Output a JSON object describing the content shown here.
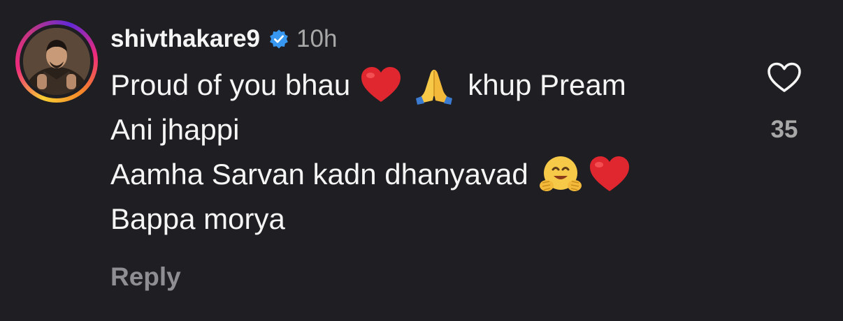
{
  "comment": {
    "username": "shivthakare9",
    "time": "10h",
    "lines": [
      {
        "before": "Proud of you bhau",
        "after": "khup Pream"
      },
      {
        "text": "Ani jhappi"
      },
      {
        "before": "Aamha Sarvan kadn dhanyavad"
      },
      {
        "text": "Bappa morya"
      }
    ],
    "reply_label": "Reply",
    "like_count": "35"
  },
  "icons": {
    "verified": "verified-badge-icon",
    "like": "heart-outline-icon",
    "emoji_heart": "red-heart-emoji",
    "emoji_pray": "folded-hands-emoji",
    "emoji_hug": "hugging-face-emoji"
  },
  "colors": {
    "background": "#1f1f23",
    "text": "#f5f5f5",
    "secondary": "#a8a8a8",
    "reply": "#8e8e93",
    "verified": "#3897f0",
    "heart": "#e0262f"
  }
}
